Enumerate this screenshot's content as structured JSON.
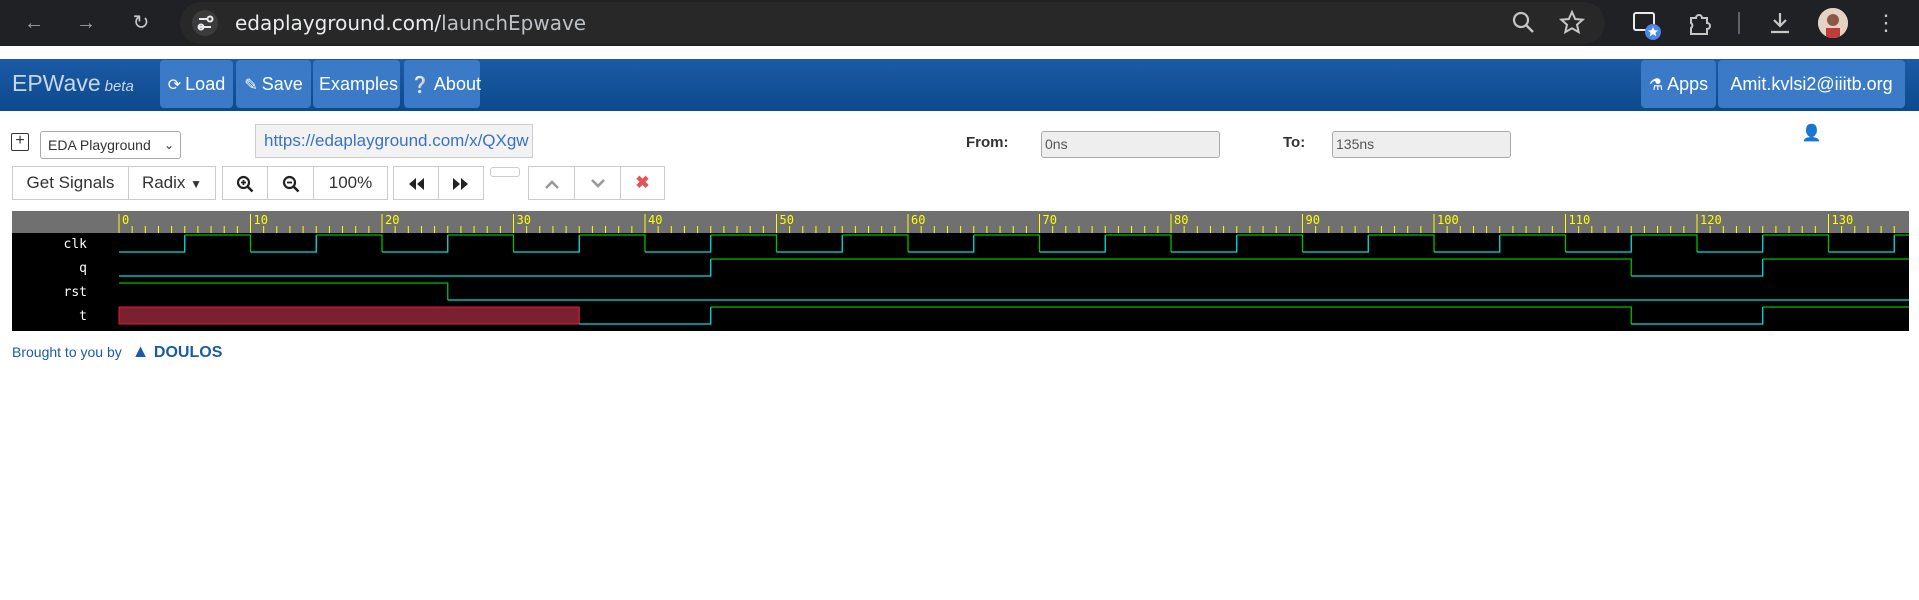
{
  "browser": {
    "url_host": "edaplayground.com/",
    "url_path": "launchEpwave"
  },
  "app": {
    "brand": "EPWave",
    "brand_suffix": "beta",
    "nav": {
      "load": "Load",
      "save": "Save",
      "examples": "Examples",
      "about": "About",
      "apps": "Apps",
      "user": "Amit.kvlsi2@iiitb.org"
    }
  },
  "toolbar": {
    "source_select": "EDA Playground",
    "share_url": "https://edaplayground.com/x/QXgw",
    "from_label": "From:",
    "from_value": "0ns",
    "to_label": "To:",
    "to_value": "135ns",
    "get_signals": "Get Signals",
    "radix": "Radix",
    "zoom_level": "100%"
  },
  "colors": {
    "app_bar": "#1b5aa6",
    "button": "#3a7ac6",
    "wave_bg": "#000000",
    "ruler_bg": "#707070",
    "ruler_text": "#ffff00",
    "signal_green": "#00c000",
    "signal_cyan": "#00e0e0",
    "unknown_fill": "#7a2030",
    "unknown_edge": "#e02030"
  },
  "waveform": {
    "time_range_ns": [
      0,
      135
    ],
    "ruler_labels": [
      "0",
      "10",
      "20",
      "30",
      "40",
      "50",
      "60",
      "70",
      "80",
      "90",
      "100",
      "110",
      "120",
      "130"
    ],
    "signals": [
      {
        "name": "clk"
      },
      {
        "name": "q"
      },
      {
        "name": "rst"
      },
      {
        "name": "t"
      }
    ],
    "signal_data": {
      "clk": {
        "type": "clock",
        "half_period_ns": 5,
        "first_rise_ns": 5
      },
      "q": {
        "transitions": [
          [
            0,
            0
          ],
          [
            45,
            1
          ],
          [
            115,
            0
          ],
          [
            125,
            1
          ]
        ]
      },
      "rst": {
        "transitions": [
          [
            0,
            1
          ],
          [
            25,
            0
          ]
        ]
      },
      "t": {
        "unknown_until_ns": 35,
        "transitions": [
          [
            35,
            0
          ],
          [
            45,
            1
          ],
          [
            115,
            0
          ],
          [
            125,
            1
          ]
        ]
      }
    }
  },
  "footer": {
    "text": "Brought to you by",
    "company": "DOULOS"
  }
}
